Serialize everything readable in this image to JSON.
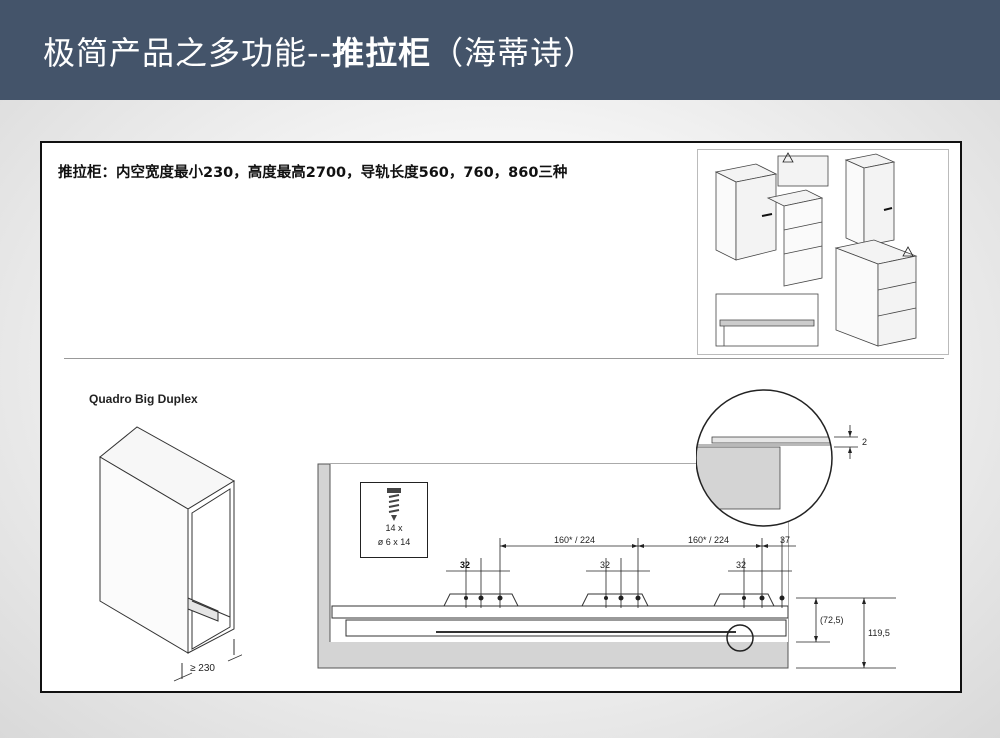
{
  "slide": {
    "title_prefix": "极简产品之多功能--",
    "title_bold": "推拉柜",
    "title_suffix": "（海蒂诗）"
  },
  "spec": {
    "text": "推拉柜：内空宽度最小230，高度最高2700，导轨长度560，760，860三种"
  },
  "drawing": {
    "model_name": "Quadro Big Duplex",
    "min_width_label": "≥ 230",
    "screw_count": "14 x",
    "screw_size": "ø 6 x 14",
    "spacing_1": "160* / 224",
    "spacing_2": "160* / 224",
    "spacing_end": "37",
    "offset_1": "32",
    "offset_2": "32",
    "offset_3": "32",
    "height_inner": "(72,5)",
    "height_total": "119,5",
    "detail_gap": "2"
  },
  "colors": {
    "header_bg": "#44546a",
    "header_text": "#ffffff",
    "panel_gray": "#d4d4d4"
  }
}
